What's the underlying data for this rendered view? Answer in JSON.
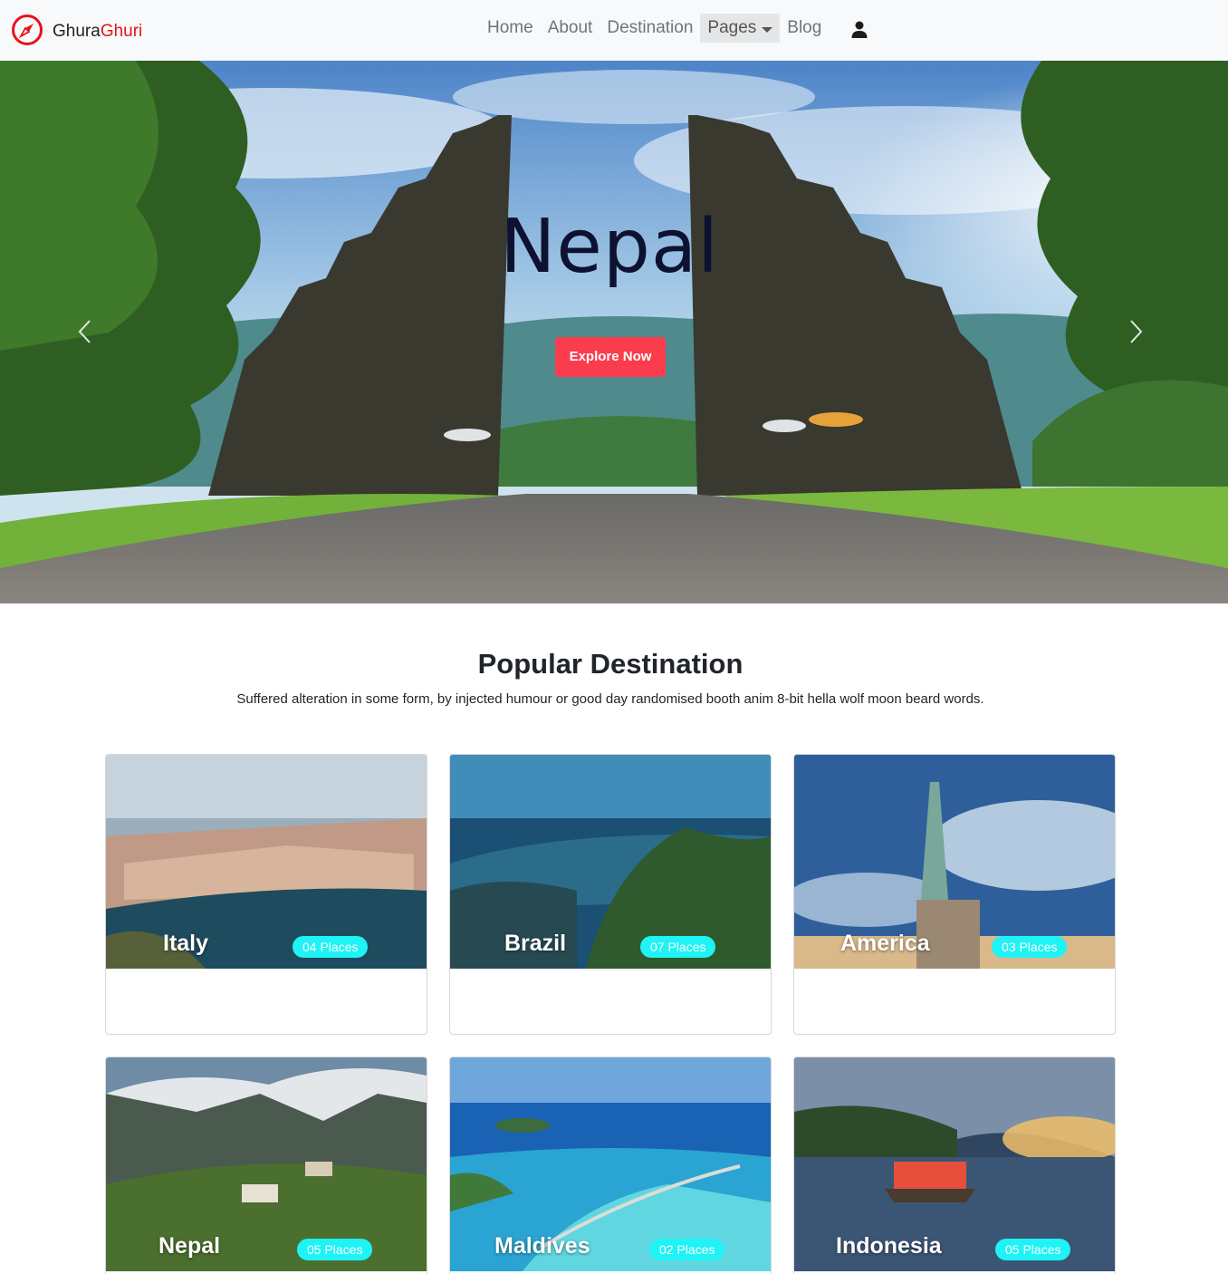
{
  "brand": {
    "name_part1": "Ghura",
    "name_part2": "Ghuri",
    "accent_color": "#e8121a",
    "logo_icon": "compass-icon"
  },
  "nav": {
    "items": [
      {
        "label": "Home"
      },
      {
        "label": "About"
      },
      {
        "label": "Destination"
      },
      {
        "label": "Pages",
        "has_dropdown": true
      },
      {
        "label": "Blog"
      }
    ],
    "user_icon": "user-icon"
  },
  "hero": {
    "title": "Nepal",
    "button_label": "Explore Now",
    "button_color": "#fb3c4c",
    "prev_icon": "chevron-left-icon",
    "next_icon": "chevron-right-icon"
  },
  "section": {
    "title": "Popular Destination",
    "subtitle": "Suffered alteration in some form, by injected humour or good day randomised booth anim 8-bit hella wolf moon beard words."
  },
  "destinations": [
    {
      "name": "Italy",
      "places": "04 Places"
    },
    {
      "name": "Brazil",
      "places": "07 Places"
    },
    {
      "name": "America",
      "places": "03 Places"
    },
    {
      "name": "Nepal",
      "places": "05 Places"
    },
    {
      "name": "Maldives",
      "places": "02 Places"
    },
    {
      "name": "Indonesia",
      "places": "05 Places"
    }
  ],
  "badge_color": "#1ff3f5"
}
